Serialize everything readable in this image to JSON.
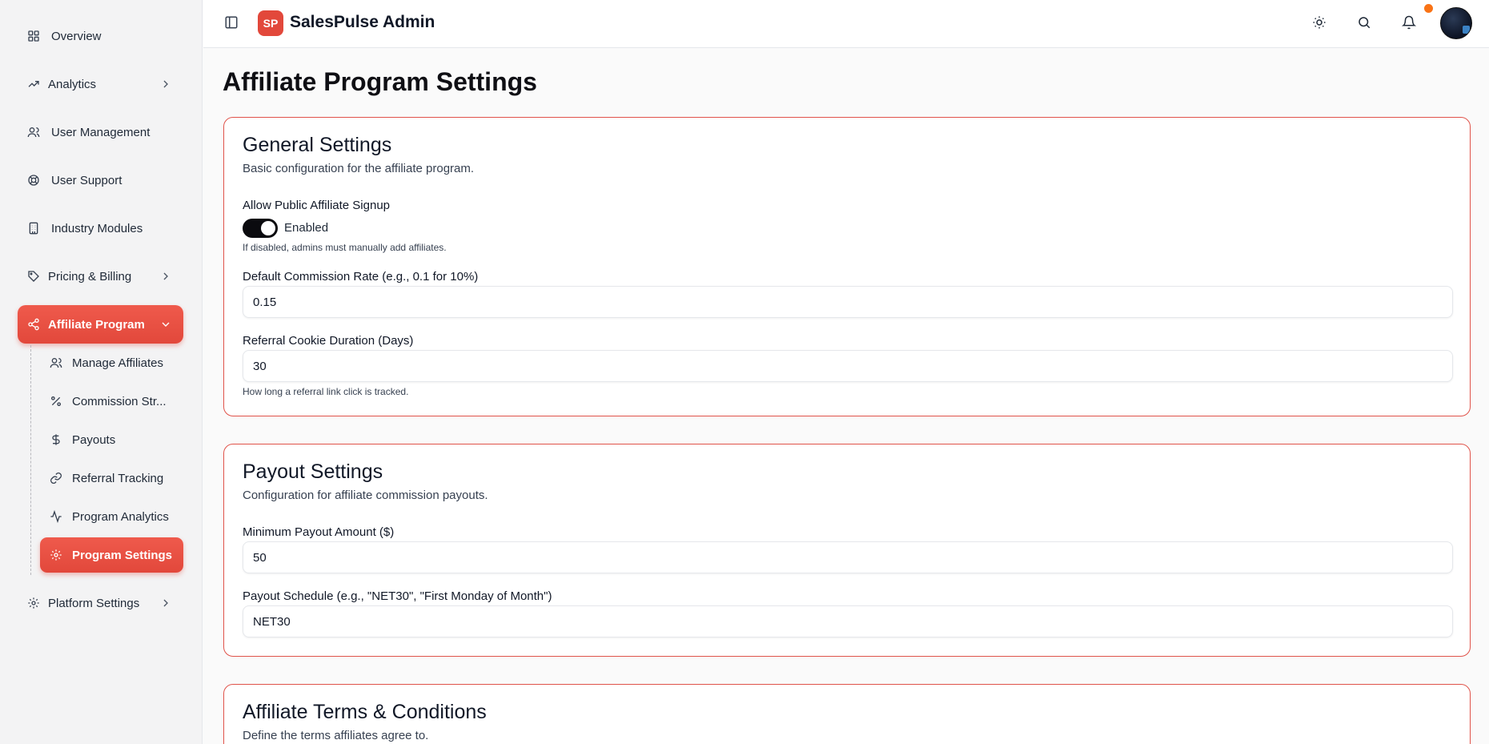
{
  "app": {
    "logo_text": "SP",
    "title": "SalesPulse Admin"
  },
  "sidebar": {
    "items": [
      {
        "label": "Overview",
        "icon": "grid-icon"
      },
      {
        "label": "Analytics",
        "icon": "trending-up-icon"
      },
      {
        "label": "User Management",
        "icon": "users-icon"
      },
      {
        "label": "User Support",
        "icon": "lifebuoy-icon"
      },
      {
        "label": "Industry Modules",
        "icon": "building-icon"
      },
      {
        "label": "Pricing & Billing",
        "icon": "tag-icon"
      },
      {
        "label": "Affiliate Program",
        "icon": "share-icon"
      },
      {
        "label": "Platform Settings",
        "icon": "gear-icon"
      }
    ],
    "affiliate_subitems": [
      {
        "label": "Manage Affiliates",
        "icon": "users-icon"
      },
      {
        "label": "Commission Str...",
        "icon": "percent-icon"
      },
      {
        "label": "Payouts",
        "icon": "dollar-icon"
      },
      {
        "label": "Referral Tracking",
        "icon": "link-icon"
      },
      {
        "label": "Program Analytics",
        "icon": "activity-icon"
      },
      {
        "label": "Program Settings",
        "icon": "gear-icon"
      }
    ],
    "active_item": "Affiliate Program",
    "active_subitem": "Program Settings"
  },
  "page": {
    "title": "Affiliate Program Settings"
  },
  "general": {
    "title": "General Settings",
    "description": "Basic configuration for the affiliate program.",
    "signup_label": "Allow Public Affiliate Signup",
    "signup_state": "Enabled",
    "signup_hint": "If disabled, admins must manually add affiliates.",
    "commission_label": "Default Commission Rate (e.g., 0.1 for 10%)",
    "commission_value": "0.15",
    "cookie_label": "Referral Cookie Duration (Days)",
    "cookie_value": "30",
    "cookie_hint": "How long a referral link click is tracked."
  },
  "payout": {
    "title": "Payout Settings",
    "description": "Configuration for affiliate commission payouts.",
    "min_label": "Minimum Payout Amount ($)",
    "min_value": "50",
    "schedule_label": "Payout Schedule (e.g., \"NET30\", \"First Monday of Month\")",
    "schedule_value": "NET30"
  },
  "terms": {
    "title": "Affiliate Terms & Conditions",
    "description": "Define the terms affiliates agree to."
  },
  "colors": {
    "accent": "#e2483b",
    "notification": "#f97316",
    "card_border": "#e0534a"
  }
}
